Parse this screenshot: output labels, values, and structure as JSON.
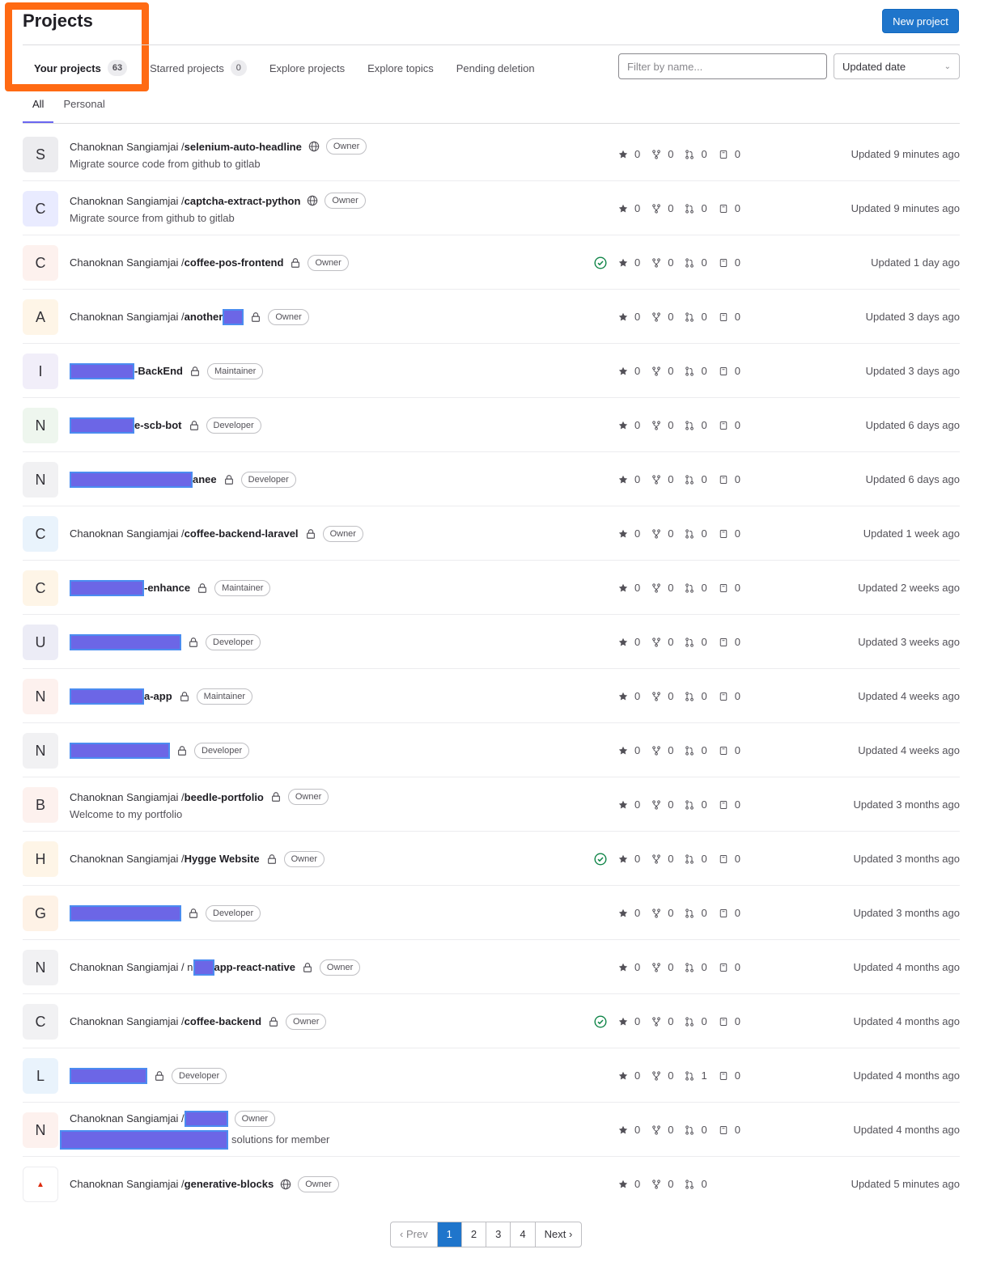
{
  "header": {
    "title": "Projects",
    "new_project_label": "New project"
  },
  "tabs": [
    {
      "label": "Your projects",
      "count": "63"
    },
    {
      "label": "Starred projects",
      "count": "0"
    },
    {
      "label": "Explore projects"
    },
    {
      "label": "Explore topics"
    },
    {
      "label": "Pending deletion"
    }
  ],
  "filter": {
    "placeholder": "Filter by name...",
    "sort_label": "Updated date"
  },
  "subtabs": [
    "All",
    "Personal"
  ],
  "colors": {
    "accent": "#1f75cb",
    "highlight": "#ff6a13",
    "redaction": "#6c66e6"
  },
  "projects": [
    {
      "avatar": "S",
      "avatar_bg": "#ececef",
      "ns": "Chanoknan Sangiamjai / ",
      "name": "selenium-auto-headline",
      "visibility": "globe-icon",
      "role": "Owner",
      "description": "Migrate source code from github to gitlab",
      "ci": false,
      "stars": "0",
      "forks": "0",
      "mrs": "0",
      "issues": "0",
      "updated": "Updated 9 minutes ago"
    },
    {
      "avatar": "C",
      "avatar_bg": "#e9ebff",
      "ns": "Chanoknan Sangiamjai / ",
      "name": "captcha-extract-python",
      "visibility": "globe-icon",
      "role": "Owner",
      "description": "Migrate source from github to gitlab",
      "ci": false,
      "stars": "0",
      "forks": "0",
      "mrs": "0",
      "issues": "0",
      "updated": "Updated 9 minutes ago"
    },
    {
      "avatar": "C",
      "avatar_bg": "#fdf1ee",
      "ns": "Chanoknan Sangiamjai / ",
      "name": "coffee-pos-frontend",
      "visibility": "lock-icon",
      "role": "Owner",
      "description": "",
      "ci": true,
      "stars": "0",
      "forks": "0",
      "mrs": "0",
      "issues": "0",
      "updated": "Updated 1 day ago"
    },
    {
      "avatar": "A",
      "avatar_bg": "#fef5e7",
      "ns": "Chanoknan Sangiamjai / ",
      "name": "another",
      "redact_after": 26,
      "visibility": "lock-icon",
      "role": "Owner",
      "description": "",
      "ci": false,
      "stars": "0",
      "forks": "0",
      "mrs": "0",
      "issues": "0",
      "updated": "Updated 3 days ago"
    },
    {
      "avatar": "I",
      "avatar_bg": "#f1eef9",
      "ns": "",
      "redact_before": 80,
      "name": "-BackEnd",
      "visibility": "lock-icon",
      "role": "Maintainer",
      "description": "",
      "ci": false,
      "stars": "0",
      "forks": "0",
      "mrs": "0",
      "issues": "0",
      "updated": "Updated 3 days ago"
    },
    {
      "avatar": "N",
      "avatar_bg": "#eef6ee",
      "ns": "",
      "redact_before": 80,
      "name": "e-scb-bot",
      "visibility": "lock-icon",
      "role": "Developer",
      "description": "",
      "ci": false,
      "stars": "0",
      "forks": "0",
      "mrs": "0",
      "issues": "0",
      "updated": "Updated 6 days ago"
    },
    {
      "avatar": "N",
      "avatar_bg": "#f1f1f3",
      "ns": "",
      "redact_before": 152,
      "name": "anee",
      "visibility": "lock-icon",
      "role": "Developer",
      "description": "",
      "ci": false,
      "stars": "0",
      "forks": "0",
      "mrs": "0",
      "issues": "0",
      "updated": "Updated 6 days ago"
    },
    {
      "avatar": "C",
      "avatar_bg": "#e9f3fc",
      "ns": "Chanoknan Sangiamjai / ",
      "name": "coffee-backend-laravel",
      "visibility": "lock-icon",
      "role": "Owner",
      "description": "",
      "ci": false,
      "stars": "0",
      "forks": "0",
      "mrs": "0",
      "issues": "0",
      "updated": "Updated 1 week ago"
    },
    {
      "avatar": "C",
      "avatar_bg": "#fef5e7",
      "ns": "",
      "redact_before": 92,
      "name": "-enhance",
      "visibility": "lock-icon",
      "role": "Maintainer",
      "description": "",
      "ci": false,
      "stars": "0",
      "forks": "0",
      "mrs": "0",
      "issues": "0",
      "updated": "Updated 2 weeks ago"
    },
    {
      "avatar": "U",
      "avatar_bg": "#ececf6",
      "ns": "",
      "redact_before": 138,
      "name": "",
      "visibility": "lock-icon",
      "role": "Developer",
      "description": "",
      "ci": false,
      "stars": "0",
      "forks": "0",
      "mrs": "0",
      "issues": "0",
      "updated": "Updated 3 weeks ago"
    },
    {
      "avatar": "N",
      "avatar_bg": "#fdf1ee",
      "ns": "",
      "redact_before": 92,
      "name": "a-app",
      "visibility": "lock-icon",
      "role": "Maintainer",
      "description": "",
      "ci": false,
      "stars": "0",
      "forks": "0",
      "mrs": "0",
      "issues": "0",
      "updated": "Updated 4 weeks ago"
    },
    {
      "avatar": "N",
      "avatar_bg": "#f1f1f3",
      "ns": "",
      "redact_before": 124,
      "name": "",
      "visibility": "lock-icon",
      "role": "Developer",
      "description": "",
      "ci": false,
      "stars": "0",
      "forks": "0",
      "mrs": "0",
      "issues": "0",
      "updated": "Updated 4 weeks ago"
    },
    {
      "avatar": "B",
      "avatar_bg": "#fdf1ee",
      "ns": "Chanoknan Sangiamjai / ",
      "name": "beedle-portfolio",
      "visibility": "lock-icon",
      "role": "Owner",
      "description": "Welcome to my portfolio",
      "ci": false,
      "stars": "0",
      "forks": "0",
      "mrs": "0",
      "issues": "0",
      "updated": "Updated 3 months ago"
    },
    {
      "avatar": "H",
      "avatar_bg": "#fef5e7",
      "ns": "Chanoknan Sangiamjai / ",
      "name": "Hygge Website",
      "visibility": "lock-icon",
      "role": "Owner",
      "description": "",
      "ci": true,
      "stars": "0",
      "forks": "0",
      "mrs": "0",
      "issues": "0",
      "updated": "Updated 3 months ago"
    },
    {
      "avatar": "G",
      "avatar_bg": "#fef2e6",
      "ns": "",
      "redact_before": 138,
      "name": "",
      "visibility": "lock-icon",
      "role": "Developer",
      "description": "",
      "ci": false,
      "stars": "0",
      "forks": "0",
      "mrs": "0",
      "issues": "0",
      "updated": "Updated 3 months ago"
    },
    {
      "avatar": "N",
      "avatar_bg": "#f1f1f3",
      "ns": "Chanoknan Sangiamjai / n",
      "redact_mid": 26,
      "name": "app-react-native",
      "visibility": "lock-icon",
      "role": "Owner",
      "description": "",
      "ci": false,
      "stars": "0",
      "forks": "0",
      "mrs": "0",
      "issues": "0",
      "updated": "Updated 4 months ago"
    },
    {
      "avatar": "C",
      "avatar_bg": "#f1f1f3",
      "ns": "Chanoknan Sangiamjai / ",
      "name": "coffee-backend",
      "visibility": "lock-icon",
      "role": "Owner",
      "description": "",
      "ci": true,
      "stars": "0",
      "forks": "0",
      "mrs": "0",
      "issues": "0",
      "updated": "Updated 4 months ago"
    },
    {
      "avatar": "L",
      "avatar_bg": "#e9f3fc",
      "ns": "",
      "redact_before": 96,
      "name": "",
      "visibility": "lock-icon",
      "role": "Developer",
      "description": "",
      "ci": false,
      "stars": "0",
      "forks": "0",
      "mrs": "1",
      "issues": "0",
      "updated": "Updated 4 months ago"
    },
    {
      "avatar": "N",
      "avatar_bg": "#fdf1ee",
      "ns": "Chanoknan Sangiamjai / ",
      "redact_after": 54,
      "name": "",
      "visibility": "",
      "role": "Owner",
      "description": "solutions for member",
      "redact_desc": 208,
      "ci": false,
      "stars": "0",
      "forks": "0",
      "mrs": "0",
      "issues": "0",
      "updated": "Updated 4 months ago"
    },
    {
      "avatar": "▲",
      "avatar_bg": "#ffffff",
      "avatar_fg": "#dd2b0e",
      "ns": "Chanoknan Sangiamjai / ",
      "name": "generative-blocks",
      "visibility": "globe-icon",
      "role": "Owner",
      "description": "",
      "ci": false,
      "stars": "0",
      "forks": "0",
      "mrs": "0",
      "issues": "",
      "updated": "Updated 5 minutes ago"
    }
  ],
  "pagination": {
    "prev": "‹ Prev",
    "pages": [
      "1",
      "2",
      "3",
      "4"
    ],
    "current": "1",
    "next": "Next ›"
  }
}
